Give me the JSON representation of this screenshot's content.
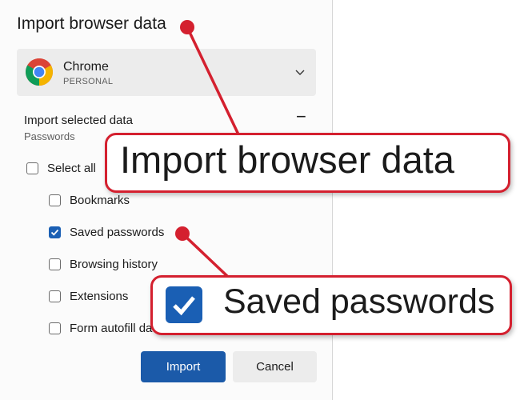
{
  "dialog": {
    "title": "Import browser data",
    "profile": {
      "browser_name": "Chrome",
      "profile_label": "PERSONAL",
      "icon": "chrome-logo-icon"
    },
    "section": {
      "heading": "Import selected data",
      "subheading": "Passwords",
      "collapse_glyph": "−"
    },
    "select_all": {
      "label": "Select all",
      "checked": false
    },
    "items": [
      {
        "label": "Bookmarks",
        "checked": false
      },
      {
        "label": "Saved passwords",
        "checked": true
      },
      {
        "label": "Browsing history",
        "checked": false
      },
      {
        "label": "Extensions",
        "checked": false
      },
      {
        "label": "Form autofill data",
        "checked": false
      }
    ],
    "buttons": {
      "import_label": "Import",
      "cancel_label": "Cancel"
    }
  },
  "annotations": {
    "callout_title_text": "Import browser data",
    "callout_item_text": "Saved passwords",
    "accent_color": "#d4202f"
  },
  "colors": {
    "checkbox_checked": "#1a5fb4",
    "primary_button": "#1b5aa9"
  }
}
